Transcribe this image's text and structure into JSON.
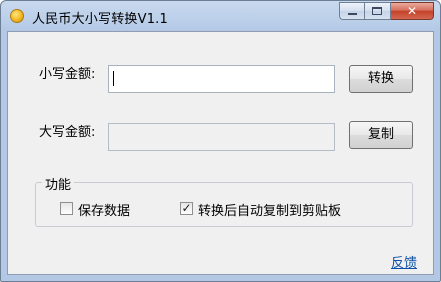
{
  "window": {
    "title": "人民币大小写转换V1.1",
    "icon": "coin-icon",
    "controls": {
      "minimize": "minimize-icon",
      "maximize": "maximize-icon",
      "close_glyph": "✕"
    }
  },
  "lowercase": {
    "label": "小写金额:",
    "value": "",
    "button_label": "转换"
  },
  "uppercase": {
    "label": "大写金额:",
    "value": "",
    "button_label": "复制"
  },
  "functions": {
    "title": "功能",
    "options": [
      {
        "label": "保存数据",
        "checked": false
      },
      {
        "label": "转换后自动复制到剪贴板",
        "checked": true
      }
    ]
  },
  "footer": {
    "feedback_link": "反馈"
  },
  "colors": {
    "title_bar": "#bcd0ea",
    "client_bg": "#f0f0f0",
    "link": "#0a4fa8",
    "close_button": "#c4422a"
  }
}
